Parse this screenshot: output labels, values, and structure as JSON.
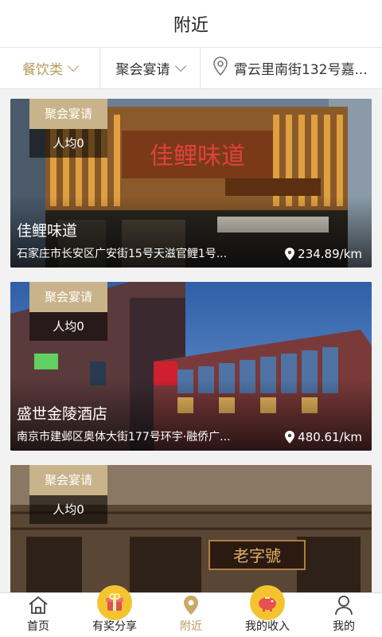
{
  "header": {
    "title": "附近"
  },
  "filters": {
    "category": "餐饮类",
    "occasion": "聚会宴请",
    "location": "霄云里南街132号嘉..."
  },
  "cards": [
    {
      "tag": "聚会宴请",
      "avg": "人均0",
      "name": "佳鲤味道",
      "address": "石家庄市长安区广安街15号天滋官鲤1号...",
      "distance": "234.89/km",
      "sign_text": "佳鲤味道",
      "theme": "wood"
    },
    {
      "tag": "聚会宴请",
      "avg": "人均0",
      "name": "盛世金陵酒店",
      "address": "南京市建邺区奥体大街177号环宇·融侨广...",
      "distance": "480.61/km",
      "theme": "night"
    },
    {
      "tag": "聚会宴请",
      "avg": "人均0",
      "name": "",
      "address": "",
      "distance": "",
      "sign_text": "老字號",
      "theme": "old"
    }
  ],
  "tabbar": {
    "items": [
      {
        "label": "首页",
        "icon": "home-icon"
      },
      {
        "label": "有奖分享",
        "icon": "gift-icon"
      },
      {
        "label": "附近",
        "icon": "location-icon"
      },
      {
        "label": "我的收入",
        "icon": "piggy-bank-icon"
      },
      {
        "label": "我的",
        "icon": "user-icon"
      }
    ],
    "active_index": 2
  },
  "colors": {
    "accent": "#b89a5a",
    "tag_bg": "#c9b38a",
    "bubble": "#f4c430"
  }
}
